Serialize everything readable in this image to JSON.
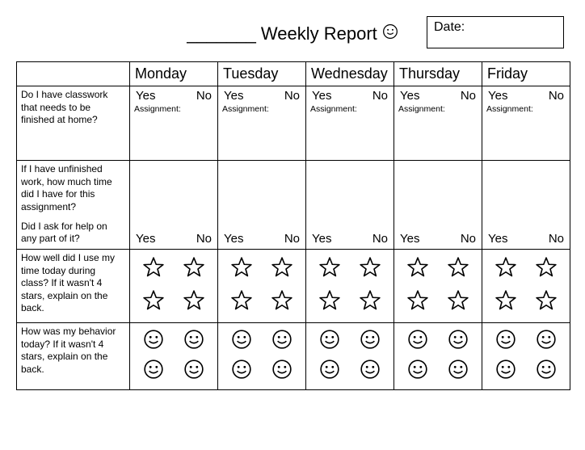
{
  "header": {
    "title_blank": "_______",
    "title_text": "Weekly Report",
    "date_label": "Date:"
  },
  "days": {
    "mon": "Monday",
    "tue": "Tuesday",
    "wed": "Wednesday",
    "thu": "Thursday",
    "fri": "Friday"
  },
  "questions": {
    "q1": "Do I have classwork that needs to be finished at home?",
    "q2a": "If I have unfinished work, how much time did I have for this assignment?",
    "q2b": "Did I ask for help on any part of it?",
    "q3": "How well did I use my time today during class? If it wasn't 4 stars, explain on the back.",
    "q4": "How was my behavior today? If it wasn't 4 stars, explain on the back."
  },
  "labels": {
    "yes": "Yes",
    "no": "No",
    "assignment": "Assignment:"
  }
}
